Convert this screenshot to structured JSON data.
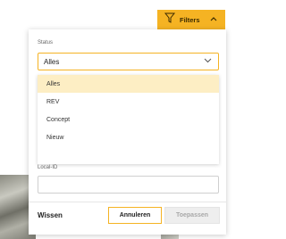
{
  "filters_button": {
    "label": "Filters",
    "icon": "filter-icon",
    "chevron": "chevron-up-icon"
  },
  "status": {
    "label": "Status",
    "selected_value": "Alles",
    "options": [
      "Alles",
      "REV",
      "Concept",
      "Nieuw"
    ]
  },
  "local_id": {
    "label": "Local-ID",
    "value": ""
  },
  "footer": {
    "clear": "Wissen",
    "cancel": "Annuleren",
    "apply": "Toepassen"
  },
  "colors": {
    "accent": "#f5b323",
    "selected_bg": "#fdeec4",
    "disabled_bg": "#eeeeee"
  }
}
